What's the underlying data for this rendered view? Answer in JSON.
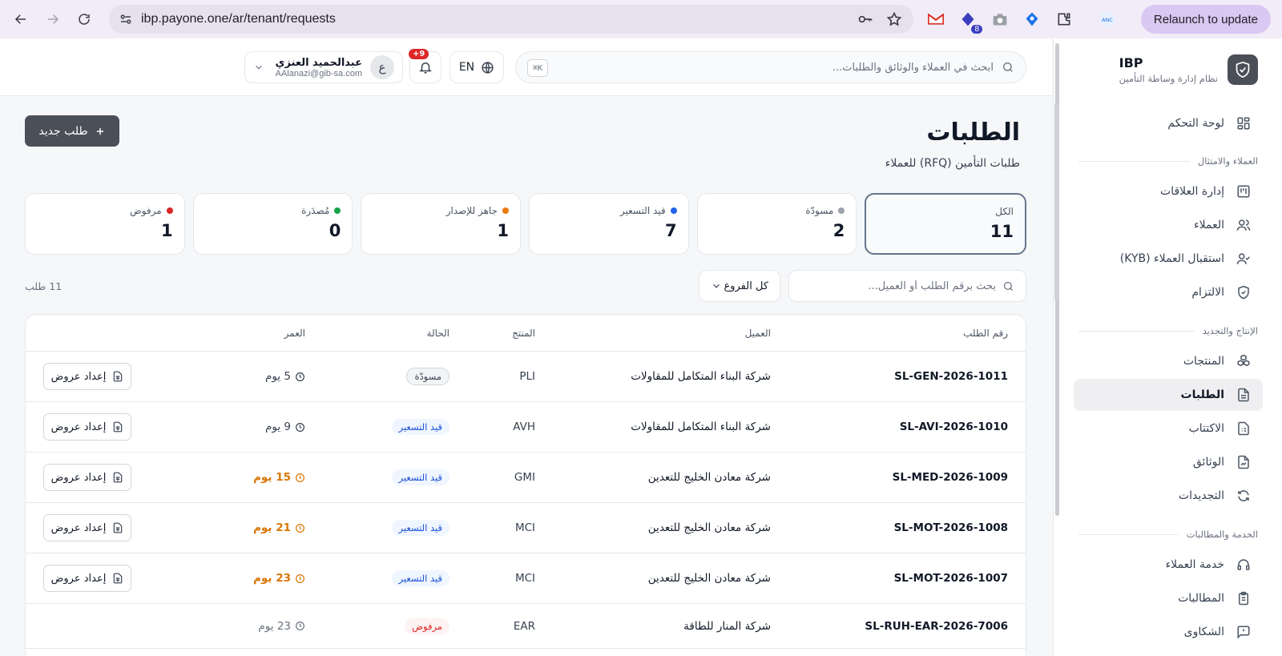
{
  "browser": {
    "url": "ibp.payone.one/ar/tenant/requests",
    "relaunch_label": "Relaunch to update",
    "ext_badge": "8"
  },
  "brand": {
    "name": "IBP",
    "subtitle": "نظام إدارة وساطة التأمين"
  },
  "sidebar": {
    "dashboard": "لوحة التحكم",
    "section_clients": "العملاء والامتثال",
    "relationships": "إدارة العلاقات",
    "clients": "العملاء",
    "kyb": "استقبال العملاء (KYB)",
    "compliance": "الالتزام",
    "section_production": "الإنتاج والتجديد",
    "products": "المنتجات",
    "requests": "الطلبات",
    "underwriting": "الاكتتاب",
    "policies": "الوثائق",
    "renewals": "التجديدات",
    "section_service": "الخدمة والمطالبات",
    "customer_service": "خدمة العملاء",
    "claims": "المطالبات",
    "complaints": "الشكاوى"
  },
  "header": {
    "search_placeholder": "ابحث في العملاء والوثائق والطلبات...",
    "shortcut": "K⌘",
    "lang": "EN",
    "notif_count": "+9",
    "user_initial": "ع",
    "user_name": "عبدالحميد العنزي",
    "user_email": "AAlanazi@gib-sa.com"
  },
  "page": {
    "title": "الطلبات",
    "subtitle": "طلبات التأمين (RFQ) للعملاء",
    "new_button": "طلب جديد",
    "search_placeholder": "بحث برقم الطلب أو العميل...",
    "branch_filter": "كل الفروع",
    "count_label": "11 طلب"
  },
  "stats": [
    {
      "label": "الكل",
      "value": "11",
      "dot": "",
      "selected": true
    },
    {
      "label": "مسودّة",
      "value": "2",
      "dot": "#9ca3af"
    },
    {
      "label": "قيد التسعير",
      "value": "7",
      "dot": "#2563eb"
    },
    {
      "label": "جاهز للإصدار",
      "value": "1",
      "dot": "#ea7a0c"
    },
    {
      "label": "مُصدَرة",
      "value": "0",
      "dot": "#16a34a"
    },
    {
      "label": "مرفوض",
      "value": "1",
      "dot": "#dc2626"
    }
  ],
  "table": {
    "headers": {
      "id": "رقم الطلب",
      "client": "العميل",
      "product": "المنتج",
      "status": "الحالة",
      "age": "العمر"
    },
    "action_label": "إعداد عروض",
    "rows": [
      {
        "id": "SL-GEN-2026-1011",
        "client": "شركة البناء المتكامل للمقاولات",
        "product": "PLI",
        "status": "مسودّة",
        "status_type": "draft",
        "age": "5 يوم",
        "age_type": "normal",
        "action": true
      },
      {
        "id": "SL-AVI-2026-1010",
        "client": "شركة البناء المتكامل للمقاولات",
        "product": "AVH",
        "status": "قيد التسعير",
        "status_type": "pricing",
        "age": "9 يوم",
        "age_type": "normal",
        "action": true
      },
      {
        "id": "SL-MED-2026-1009",
        "client": "شركة معادن الخليج للتعدين",
        "product": "GMI",
        "status": "قيد التسعير",
        "status_type": "pricing",
        "age": "15 يوم",
        "age_type": "warn",
        "action": true
      },
      {
        "id": "SL-MOT-2026-1008",
        "client": "شركة معادن الخليج للتعدين",
        "product": "MCI",
        "status": "قيد التسعير",
        "status_type": "pricing",
        "age": "21 يوم",
        "age_type": "warn",
        "action": true
      },
      {
        "id": "SL-MOT-2026-1007",
        "client": "شركة معادن الخليج للتعدين",
        "product": "MCI",
        "status": "قيد التسعير",
        "status_type": "pricing",
        "age": "23 يوم",
        "age_type": "warn",
        "action": true
      },
      {
        "id": "SL-RUH-EAR-2026-7006",
        "client": "شركة المنار للطاقة",
        "product": "EAR",
        "status": "مرفوض",
        "status_type": "rejected",
        "age": "23 يوم",
        "age_type": "muted",
        "action": false
      }
    ]
  }
}
